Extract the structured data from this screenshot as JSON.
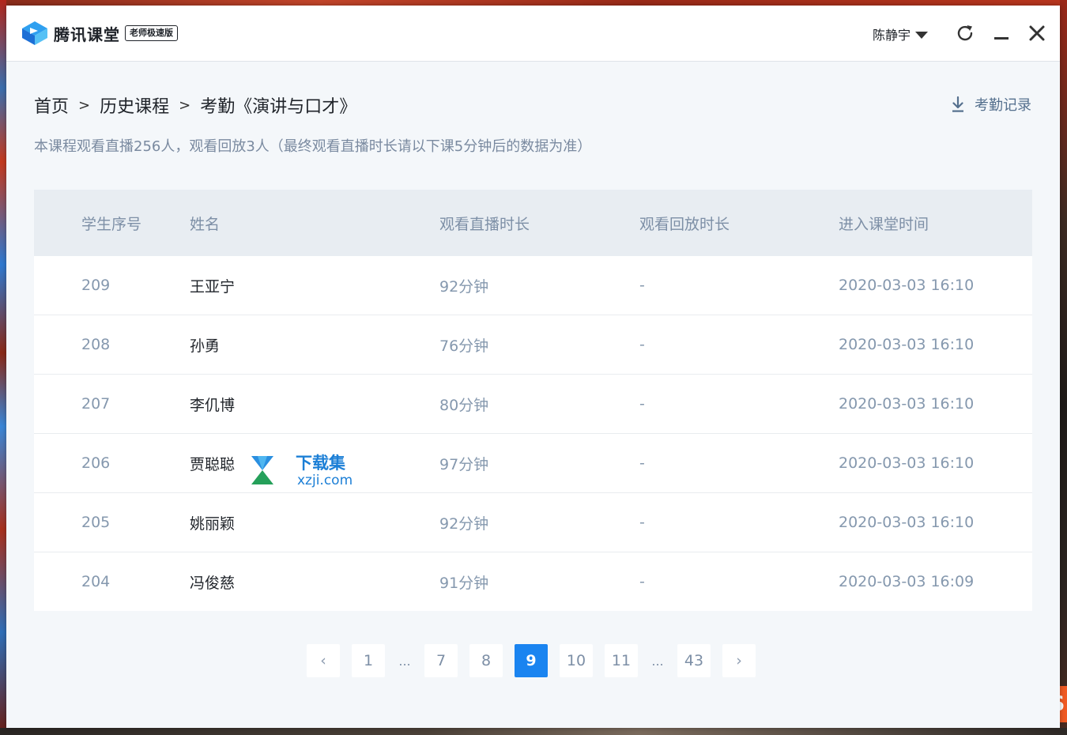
{
  "app": {
    "name": "腾讯课堂",
    "edition": "老师极速版",
    "user": "陈静宇"
  },
  "breadcrumb": {
    "home": "首页",
    "history": "历史课程",
    "current": "考勤《演讲与口才》",
    "separator": ">"
  },
  "export_label": "考勤记录",
  "summary": "本课程观看直播256人，观看回放3人（最终观看直播时长请以下课5分钟后的数据为准）",
  "table": {
    "headers": [
      "学生序号",
      "姓名",
      "观看直播时长",
      "观看回放时长",
      "进入课堂时间"
    ],
    "rows": [
      [
        "209",
        "王亚宁",
        "92分钟",
        "-",
        "2020-03-03 16:10"
      ],
      [
        "208",
        "孙勇",
        "76分钟",
        "-",
        "2020-03-03 16:10"
      ],
      [
        "207",
        "李仉博",
        "80分钟",
        "-",
        "2020-03-03 16:10"
      ],
      [
        "206",
        "贾聪聪",
        "97分钟",
        "-",
        "2020-03-03 16:10"
      ],
      [
        "205",
        "姚丽颖",
        "92分钟",
        "-",
        "2020-03-03 16:10"
      ],
      [
        "204",
        "冯俊慈",
        "91分钟",
        "-",
        "2020-03-03 16:09"
      ]
    ]
  },
  "pagination": {
    "prev": "‹",
    "next": "›",
    "ellipsis": "...",
    "pages": [
      "1",
      "7",
      "8",
      "9",
      "10",
      "11",
      "43"
    ],
    "current": "9"
  },
  "watermark": {
    "title": "下载集",
    "domain": "xzji.com"
  },
  "colors": {
    "accent": "#1a84f0",
    "header_bg": "#e8edf2",
    "page_bg": "#f4f7fa",
    "muted_text": "#7d8fa6"
  },
  "icons": [
    "logo-icon",
    "chevron-down-icon",
    "refresh-icon",
    "minimize-icon",
    "close-icon",
    "download-icon"
  ]
}
